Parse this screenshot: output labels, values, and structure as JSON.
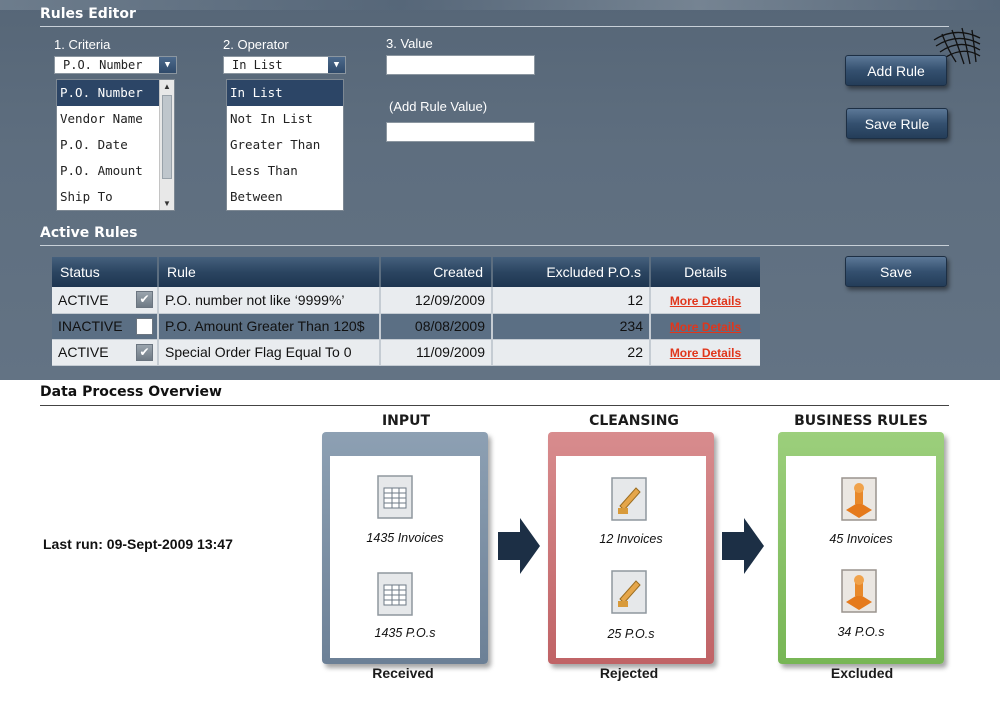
{
  "rules_editor": {
    "title": "Rules Editor",
    "criteria": {
      "label": "1. Criteria",
      "selected": "P.O. Number",
      "options": [
        "P.O. Number",
        "Vendor Name",
        "P.O. Date",
        "P.O. Amount",
        "Ship To"
      ]
    },
    "operator": {
      "label": "2. Operator",
      "selected": "In List",
      "options": [
        "In List",
        "Not In List",
        "Greater Than",
        "Less Than",
        "Between"
      ]
    },
    "value": {
      "label": "3. Value",
      "value": "",
      "add_label": "(Add Rule Value)",
      "add_value": ""
    },
    "add_rule_button": "Add Rule",
    "save_rule_button": "Save Rule"
  },
  "active_rules": {
    "title": "Active Rules",
    "save_button": "Save",
    "columns": [
      "Status",
      "Rule",
      "Created",
      "Excluded P.O.s",
      "Details"
    ],
    "rows": [
      {
        "status": "ACTIVE",
        "checked": true,
        "rule": "P.O. number not like ‘9999%’",
        "created": "12/09/2009",
        "excluded": "12",
        "details": "More Details"
      },
      {
        "status": "INACTIVE",
        "checked": false,
        "rule": "P.O. Amount Greater Than 120$",
        "created": "08/08/2009",
        "excluded": "234",
        "details": "More Details"
      },
      {
        "status": "ACTIVE",
        "checked": true,
        "rule": "Special Order Flag Equal To 0",
        "created": "11/09/2009",
        "excluded": "22",
        "details": "More Details"
      }
    ]
  },
  "overview": {
    "title": "Data Process Overview",
    "last_run": "Last run: 09-Sept-2009 13:47",
    "stages": [
      {
        "title": "INPUT",
        "footer": "Received",
        "color": "#7f93a8",
        "items": [
          "1435 Invoices",
          "1435 P.O.s"
        ],
        "icon": "spreadsheet-icon"
      },
      {
        "title": "CLEANSING",
        "footer": "Rejected",
        "color": "#cc7679",
        "items": [
          "12 Invoices",
          "25 P.O.s"
        ],
        "icon": "cleansing-doc-icon"
      },
      {
        "title": "BUSINESS RULES",
        "footer": "Excluded",
        "color": "#88c266",
        "items": [
          "45 Invoices",
          "34 P.O.s"
        ],
        "icon": "rules-engine-icon"
      }
    ]
  }
}
